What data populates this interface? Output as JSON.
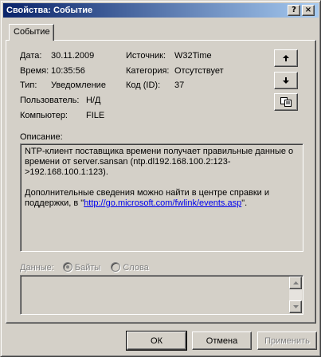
{
  "window": {
    "title": "Свойства: Событие",
    "help_glyph": "?",
    "close_glyph": "×"
  },
  "tab": {
    "label": "Событие"
  },
  "fields": {
    "date_label": "Дата:",
    "date_value": "30.11.2009",
    "time_label": "Время:",
    "time_value": "10:35:56",
    "type_label": "Тип:",
    "type_value": "Уведомление",
    "user_label": "Пользователь:",
    "user_value": "Н/Д",
    "computer_label": "Компьютер:",
    "computer_value": "FILE",
    "source_label": "Источник:",
    "source_value": "W32Time",
    "category_label": "Категория:",
    "category_value": "Отсутствует",
    "code_label": "Код (ID):",
    "code_value": "37"
  },
  "description": {
    "label": "Описание:",
    "line1": "NTP-клиент поставщика времени получает правильные данные о времени от server.sansan (ntp.dl192.168.100.2:123->192.168.100.1:123).",
    "line2_prefix": "Дополнительные сведения можно найти в центре справки и поддержки, в \"",
    "link": "http://go.microsoft.com/fwlink/events.asp",
    "line2_suffix": "\"."
  },
  "data_section": {
    "label": "Данные:",
    "radio_bytes": "Байты",
    "radio_words": "Слова"
  },
  "buttons": {
    "ok": "ОК",
    "cancel": "Отмена",
    "apply": "Применить"
  }
}
